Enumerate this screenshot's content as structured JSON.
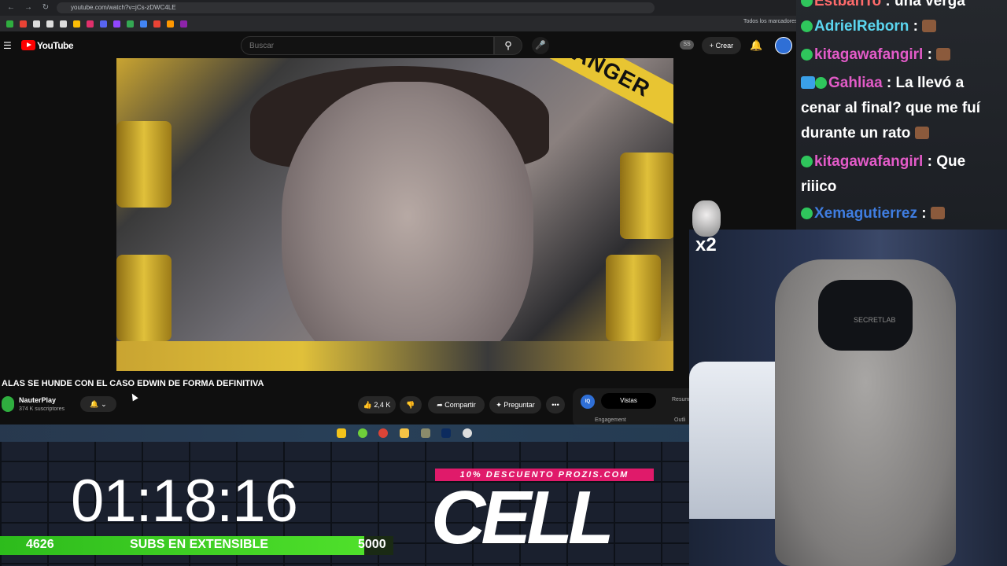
{
  "browser": {
    "url": "youtube.com/watch?v=jCs-zDWC4LE",
    "bookmarks_folder": "Todos los marcadores"
  },
  "youtube": {
    "logo_text": "YouTube",
    "search_placeholder": "Buscar",
    "badge": "SS",
    "create_label": "+ Crear",
    "video_tape_text": "DANGER",
    "video_title": "ALAS SE HUNDE CON EL CASO EDWIN DE FORMA DEFINITIVA",
    "channel_name": "NauterPlay",
    "subscribers": "374 K suscriptores",
    "like_count": "2,4 K",
    "share_label": "Compartir",
    "ask_label": "Preguntar",
    "more_label": "•••",
    "side_panel": {
      "iq_label": "IQ",
      "tab_active": "Vistas",
      "tab_other": "Resum",
      "engagement_label": "Engagement",
      "outline_label": "Outli"
    }
  },
  "stream": {
    "timer": "01:18:16",
    "goal": {
      "current": "4626",
      "label": "SUBS EN EXTENSIBLE",
      "target": "5000",
      "progress": 0.9252
    },
    "promo_banner": "10% DESCUENTO PROZIS.COM",
    "promo_name": "CELL",
    "multiplier": "x2",
    "chair_brand": "SECRETLAB"
  },
  "chat": [
    {
      "user": "EstbanTo",
      "color": "#ff6b6b",
      "text": ": una verga",
      "prefix": false,
      "emote": false
    },
    {
      "user": "AdrielReborn",
      "color": "#5bd6f0",
      "text": ":",
      "prefix": false,
      "emote": true
    },
    {
      "user": "kitagawafangirl",
      "color": "#e35bc8",
      "text": ":",
      "prefix": false,
      "emote": true
    },
    {
      "user": "Gahliaa",
      "color": "#e35bc8",
      "text": ": La llevó a cenar al final? que me fuí durante un rato",
      "prefix": true,
      "emote": true
    },
    {
      "user": "kitagawafangirl",
      "color": "#e35bc8",
      "text": ": Que riiico",
      "prefix": false,
      "emote": false
    },
    {
      "user": "Xemagutierrez",
      "color": "#3f7de0",
      "text": ":",
      "prefix": false,
      "emote": true
    }
  ],
  "colors": {
    "accent_green": "#2dbb1c",
    "promo_pink": "#e01a6a",
    "yt_red": "#ff0000"
  }
}
